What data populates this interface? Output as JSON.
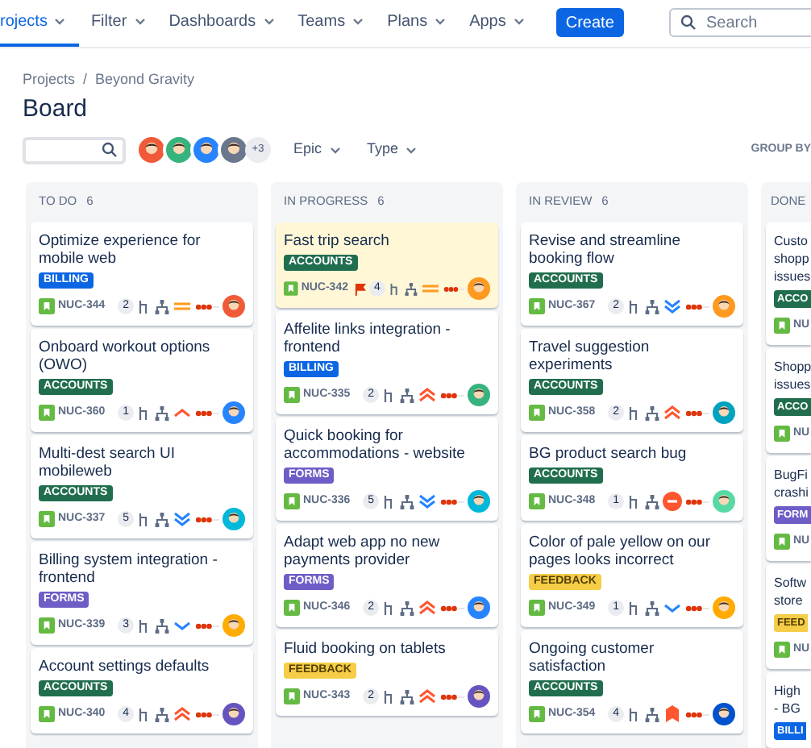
{
  "nav": {
    "items": [
      {
        "label": "rojects",
        "selected": true
      },
      {
        "label": "Filter",
        "selected": false
      },
      {
        "label": "Dashboards",
        "selected": false
      },
      {
        "label": "Teams",
        "selected": false
      },
      {
        "label": "Plans",
        "selected": false
      },
      {
        "label": "Apps",
        "selected": false
      }
    ],
    "create": "Create",
    "search": {
      "placeholder": "Search"
    }
  },
  "breadcrumbs": [
    "Projects",
    "/",
    "Beyond Gravity"
  ],
  "title": "Board",
  "filters": {
    "avatars": [
      {
        "color": "#f15a38"
      },
      {
        "color": "#36b37e"
      },
      {
        "color": "#2684ff"
      },
      {
        "color": "#6b778c"
      }
    ],
    "more": "+3",
    "dropdowns": [
      "Epic",
      "Type"
    ],
    "group_by": "GROUP BY"
  },
  "columns": [
    {
      "name": "TO DO",
      "count": "6",
      "cards": [
        {
          "title": "Optimize experience for mobile web",
          "tag": {
            "label": "BILLING",
            "kind": "billing"
          },
          "id": "NUC-344",
          "flagged": false,
          "highlighted": false,
          "count": "2",
          "priority": {
            "kind": "medium"
          },
          "assignee": {
            "color": "#f15a38"
          }
        },
        {
          "title": "Onboard workout options (OWO)",
          "tag": {
            "label": "ACCOUNTS",
            "kind": "accounts"
          },
          "id": "NUC-360",
          "flagged": false,
          "highlighted": false,
          "count": "1",
          "priority": {
            "kind": "high"
          },
          "assignee": {
            "color": "#2684ff"
          }
        },
        {
          "title": "Multi-dest search UI mobileweb",
          "tag": {
            "label": "ACCOUNTS",
            "kind": "accounts"
          },
          "id": "NUC-337",
          "flagged": false,
          "highlighted": false,
          "count": "5",
          "priority": {
            "kind": "lowest"
          },
          "assignee": {
            "color": "#00b8d9"
          }
        },
        {
          "title": "Billing system integration - frontend",
          "tag": {
            "label": "FORMS",
            "kind": "forms"
          },
          "id": "NUC-339",
          "flagged": false,
          "highlighted": false,
          "count": "3",
          "priority": {
            "kind": "low"
          },
          "assignee": {
            "color": "#ffab00"
          }
        },
        {
          "title": "Account settings defaults",
          "tag": {
            "label": "ACCOUNTS",
            "kind": "accounts"
          },
          "id": "NUC-340",
          "flagged": false,
          "highlighted": false,
          "count": "4",
          "priority": {
            "kind": "highest"
          },
          "assignee": {
            "color": "#6554c0"
          }
        }
      ]
    },
    {
      "name": "IN PROGRESS",
      "count": "6",
      "cards": [
        {
          "title": "Fast trip search",
          "tag": {
            "label": "ACCOUNTS",
            "kind": "accounts"
          },
          "id": "NUC-342",
          "flagged": true,
          "highlighted": true,
          "count": "4",
          "priority": {
            "kind": "medium"
          },
          "assignee": {
            "color": "#ff991f"
          }
        },
        {
          "title": "Affelite links integration - frontend",
          "tag": {
            "label": "BILLING",
            "kind": "billing"
          },
          "id": "NUC-335",
          "flagged": false,
          "highlighted": false,
          "count": "2",
          "priority": {
            "kind": "highest"
          },
          "assignee": {
            "color": "#36b37e"
          }
        },
        {
          "title": "Quick booking for accommodations - website",
          "tag": {
            "label": "FORMS",
            "kind": "forms"
          },
          "id": "NUC-336",
          "flagged": false,
          "highlighted": false,
          "count": "5",
          "priority": {
            "kind": "lowest"
          },
          "assignee": {
            "color": "#00b8d9"
          }
        },
        {
          "title": "Adapt web app no new payments provider",
          "tag": {
            "label": "FORMS",
            "kind": "forms"
          },
          "id": "NUC-346",
          "flagged": false,
          "highlighted": false,
          "count": "2",
          "priority": {
            "kind": "highest"
          },
          "assignee": {
            "color": "#2684ff"
          }
        },
        {
          "title": "Fluid booking on tablets",
          "tag": {
            "label": "FEEDBACK",
            "kind": "feedback"
          },
          "id": "NUC-343",
          "flagged": false,
          "highlighted": false,
          "count": "2",
          "priority": {
            "kind": "highest"
          },
          "assignee": {
            "color": "#6554c0"
          }
        }
      ]
    },
    {
      "name": "IN REVIEW",
      "count": "6",
      "cards": [
        {
          "title": "Revise and streamline booking flow",
          "tag": {
            "label": "ACCOUNTS",
            "kind": "accounts"
          },
          "id": "NUC-367",
          "flagged": false,
          "highlighted": false,
          "count": "2",
          "priority": {
            "kind": "lowest"
          },
          "assignee": {
            "color": "#ff991f"
          }
        },
        {
          "title": "Travel suggestion experiments",
          "tag": {
            "label": "ACCOUNTS",
            "kind": "accounts"
          },
          "id": "NUC-358",
          "flagged": false,
          "highlighted": false,
          "count": "2",
          "priority": {
            "kind": "highest"
          },
          "assignee": {
            "color": "#00a3bf"
          }
        },
        {
          "title": "BG product search bug",
          "tag": {
            "label": "ACCOUNTS",
            "kind": "accounts"
          },
          "id": "NUC-348",
          "flagged": false,
          "highlighted": false,
          "count": "1",
          "priority": {
            "kind": "blocker"
          },
          "assignee": {
            "color": "#57d9a3"
          }
        },
        {
          "title": "Color of pale yellow on our pages looks incorrect",
          "tag": {
            "label": "FEEDBACK",
            "kind": "feedback"
          },
          "id": "NUC-349",
          "flagged": false,
          "highlighted": false,
          "count": "1",
          "priority": {
            "kind": "low"
          },
          "assignee": {
            "color": "#ffab00"
          }
        },
        {
          "title": "Ongoing customer satisfaction",
          "tag": {
            "label": "ACCOUNTS",
            "kind": "accounts"
          },
          "id": "NUC-354",
          "flagged": false,
          "highlighted": false,
          "count": "4",
          "priority": {
            "kind": "critical"
          },
          "assignee": {
            "color": "#0052cc"
          }
        }
      ]
    }
  ],
  "done": {
    "name": "DONE",
    "cards": [
      {
        "lines": [
          "Custo",
          "shopp",
          "issues"
        ],
        "tag": {
          "label": "ACCO",
          "kind": "accounts"
        },
        "id": "NU"
      },
      {
        "lines": [
          "Shopp",
          "issues"
        ],
        "tag": {
          "label": "ACCO",
          "kind": "accounts"
        },
        "id": "NU"
      },
      {
        "lines": [
          "BugFi",
          "crashi"
        ],
        "tag": {
          "label": "FORM",
          "kind": "forms"
        },
        "id": "NU"
      },
      {
        "lines": [
          "Softw",
          "store"
        ],
        "tag": {
          "label": "FEED",
          "kind": "feedback"
        },
        "id": "NU"
      },
      {
        "lines": [
          "High",
          "- BG"
        ],
        "tag": {
          "label": "BILLI",
          "kind": "billing"
        }
      }
    ]
  }
}
